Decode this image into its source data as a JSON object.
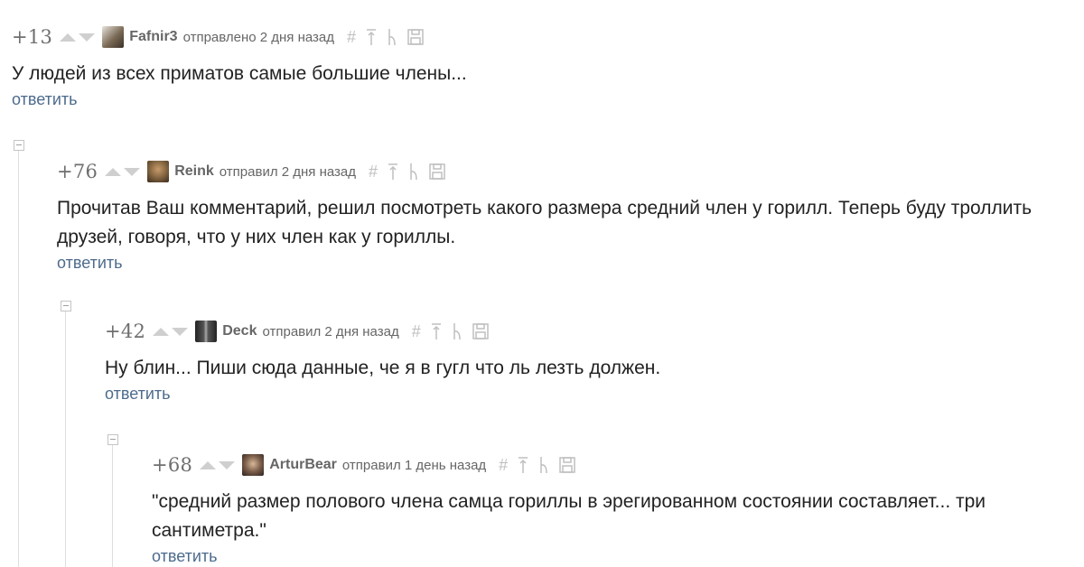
{
  "comments": [
    {
      "rating": "+13",
      "author": "Fafnir3",
      "meta": "отправлено 2 дня назад",
      "text": "У людей из всех приматов самые большие члены...",
      "reply": "ответить",
      "avatar_color": "#7a6a55"
    },
    {
      "rating": "+76",
      "author": "Reink",
      "meta": "отправил 2 дня назад",
      "text": "Прочитав Ваш комментарий, решил посмотреть какого размера средний член у горилл. Теперь буду троллить друзей, говоря, что у них член как у гориллы.",
      "reply": "ответить",
      "avatar_color": "#8a6b45"
    },
    {
      "rating": "+42",
      "author": "Deck",
      "meta": "отправил 2 дня назад",
      "text": "Ну блин... Пиши сюда данные, че я в гугл что ль лезть должен.",
      "reply": "ответить",
      "avatar_color": "#333333"
    },
    {
      "rating": "+68",
      "author": "ArturBear",
      "meta": "отправил 1 день назад",
      "text": "\"средний размер полового члена самца гориллы в эрегированном состоянии составляет... три сантиметра.\"",
      "reply": "ответить",
      "avatar_color": "#7a5d4a"
    }
  ],
  "tool_icons": [
    "hash-icon",
    "pin-icon",
    "branch-icon",
    "save-icon"
  ],
  "colors": {
    "link": "#4d6b8d",
    "muted": "#666666",
    "icon": "#bfbfbf"
  }
}
